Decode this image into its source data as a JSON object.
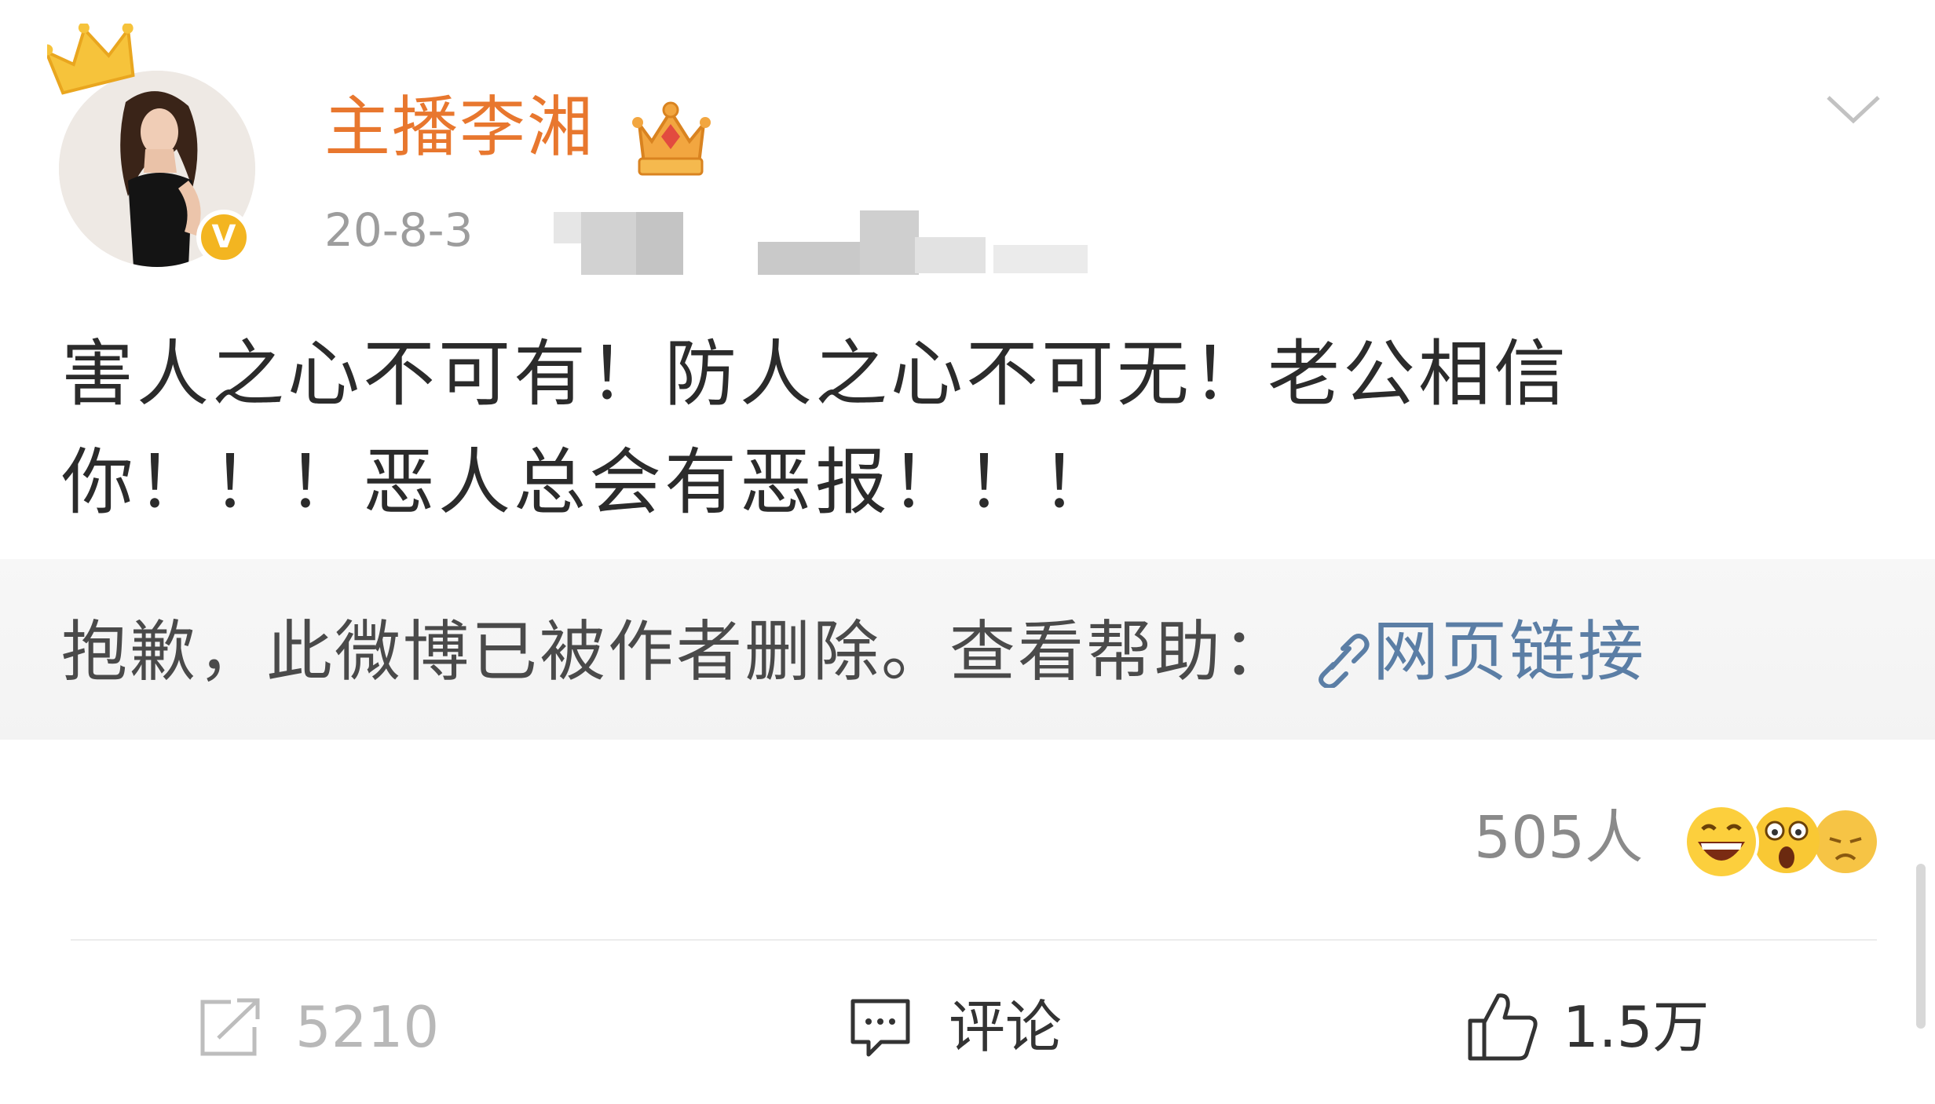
{
  "post": {
    "username": "主播李湘",
    "timestamp_visible": "20-8-3",
    "content_line1": "害人之心不可有！防人之心不可无！老公相信",
    "content_line2": "你！！！恶人总会有恶报！！！"
  },
  "retweet_box": {
    "deleted_notice": "抱歉，此微博已被作者删除。查看帮助：",
    "link_text": "网页链接"
  },
  "reactions": {
    "count_label": "505人"
  },
  "footer": {
    "repost_count": "5210",
    "comment_label": "评论",
    "like_count": "1.5万"
  },
  "colors": {
    "username": "#e8772e",
    "link": "#5b7ea5",
    "verified_badge": "#f3b521"
  },
  "icons": {
    "crown": "crown-icon",
    "vip": "vip-crown-badge-icon",
    "verified": "verified-v-icon",
    "menu": "chevron-down-icon",
    "link": "link-icon",
    "repost": "repost-icon",
    "comment": "comment-icon",
    "like": "thumbs-up-icon"
  }
}
